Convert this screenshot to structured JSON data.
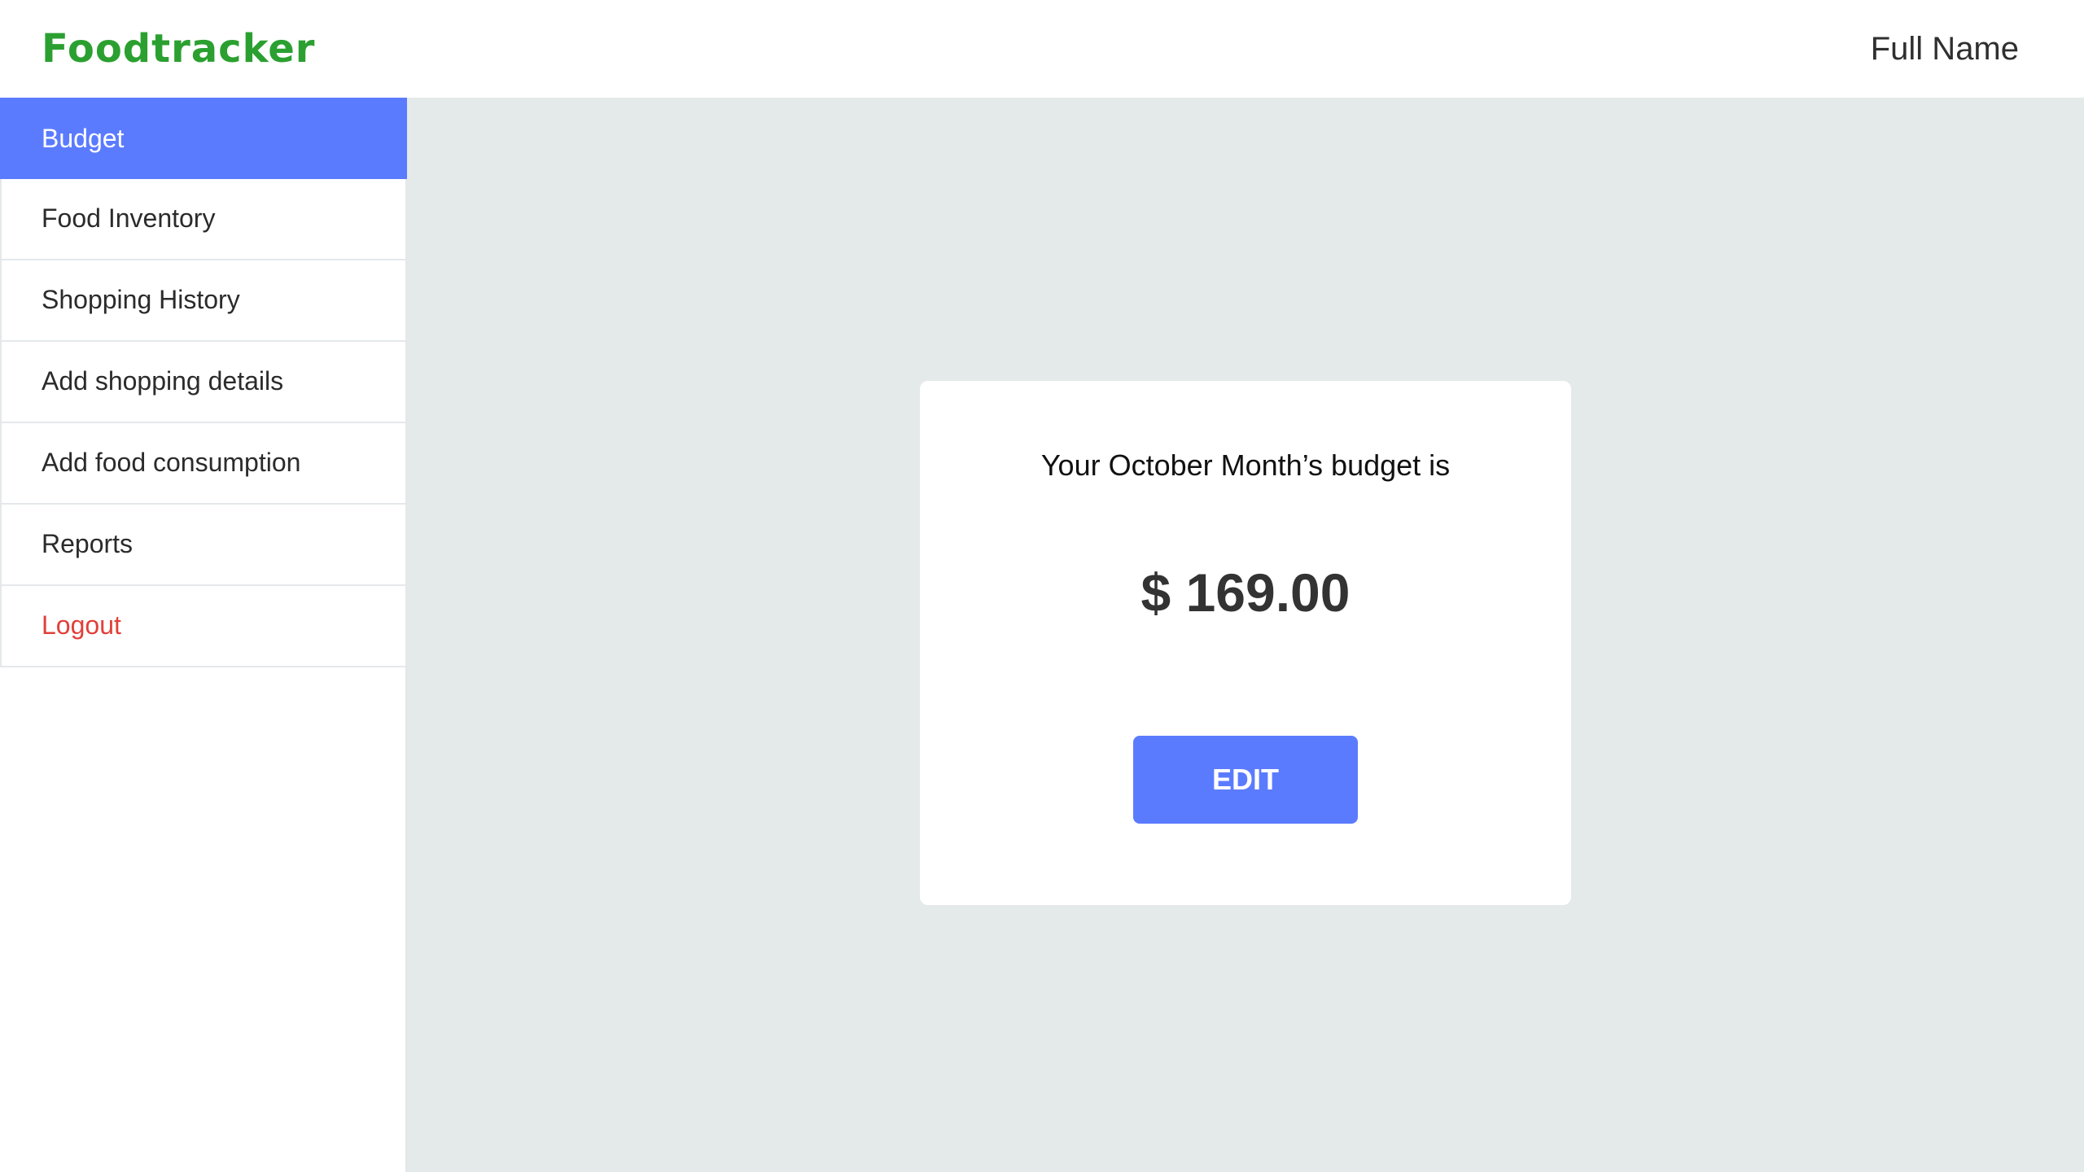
{
  "app": {
    "brand": "Foodtracker",
    "user_name": "Full Name",
    "colors": {
      "brand": "#2ba030",
      "accent": "#5b7bff",
      "logout": "#e0403a",
      "main_background": "#e4eaea"
    }
  },
  "sidebar": {
    "active_item": "Budget",
    "items": [
      {
        "label": "Budget"
      },
      {
        "label": "Food Inventory"
      },
      {
        "label": "Shopping History"
      },
      {
        "label": "Add shopping details"
      },
      {
        "label": "Add food consumption"
      },
      {
        "label": "Reports"
      },
      {
        "label": "Logout"
      }
    ]
  },
  "budget_card": {
    "caption": "Your October Month’s budget is",
    "amount": "$ 169.00",
    "edit_label": "EDIT"
  }
}
